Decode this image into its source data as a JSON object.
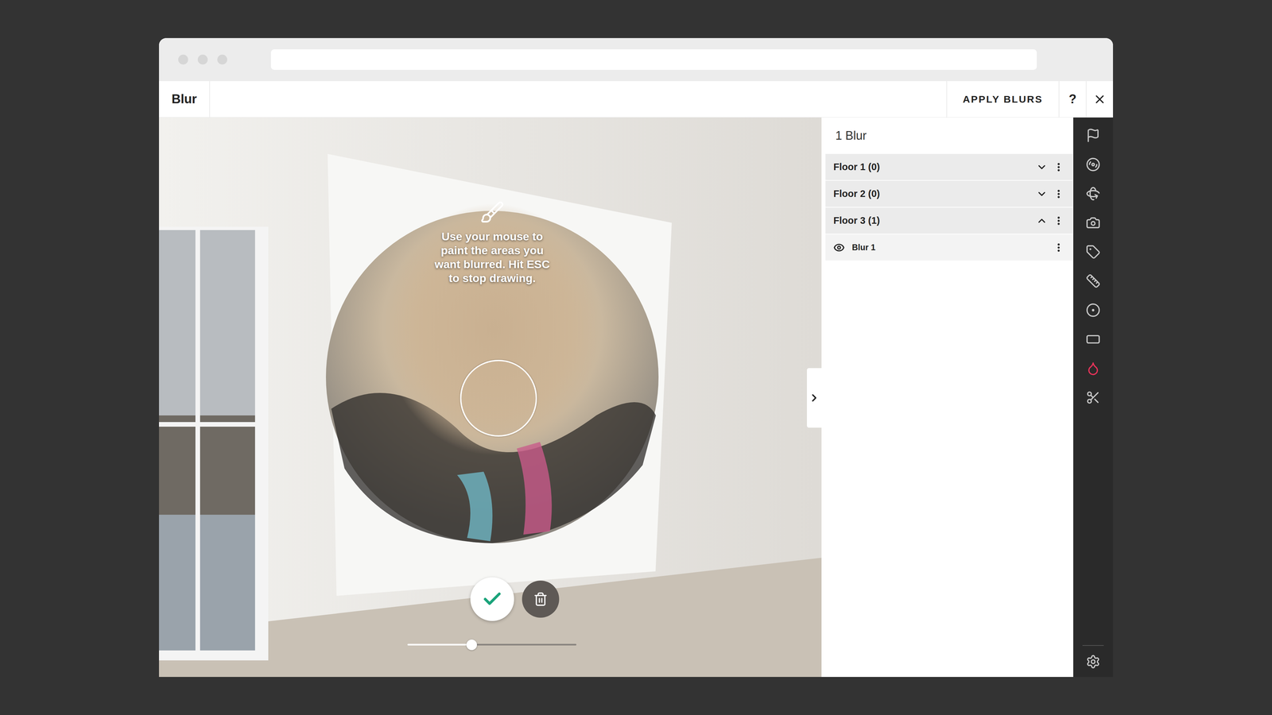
{
  "window": {
    "title": "Blur"
  },
  "header": {
    "apply": "APPLY BLURS",
    "help": "?"
  },
  "viewer": {
    "instruction": [
      "Use your mouse to",
      "paint the areas you",
      "want blurred. Hit ESC",
      "to stop drawing."
    ],
    "brush_size": {
      "level": 0.38
    }
  },
  "panel": {
    "title": "1 Blur",
    "floors": [
      {
        "label": "Floor 1 (0)",
        "expanded": false,
        "blurs": []
      },
      {
        "label": "Floor 2 (0)",
        "expanded": false,
        "blurs": []
      },
      {
        "label": "Floor 3 (1)",
        "expanded": true,
        "blurs": [
          {
            "label": "Blur 1",
            "visible": true
          }
        ]
      }
    ]
  },
  "toolbar": {
    "tools": [
      {
        "selected": false
      },
      {
        "selected": false
      },
      {
        "selected": false
      },
      {
        "selected": false
      },
      {
        "selected": false
      },
      {
        "selected": false
      },
      {
        "selected": false
      },
      {
        "selected": false
      },
      {
        "selected": true
      },
      {
        "selected": false
      }
    ]
  }
}
